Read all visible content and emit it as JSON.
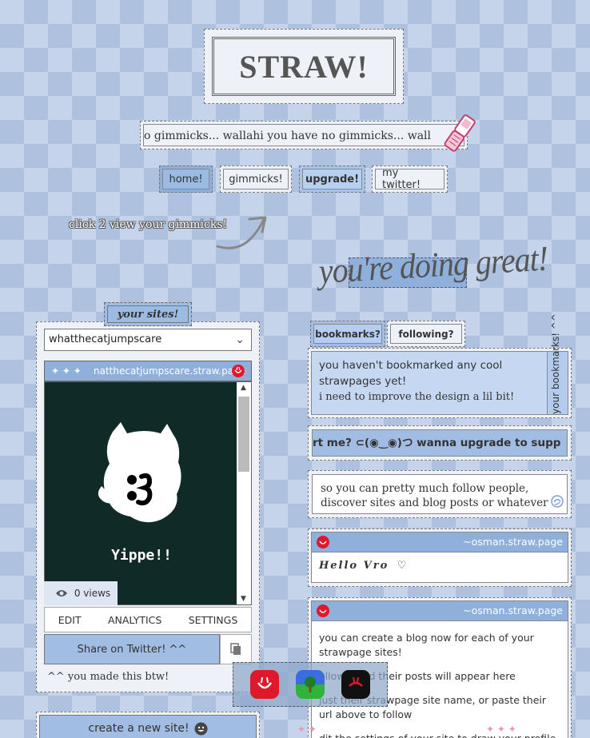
{
  "logo": {
    "text": "STRAW!"
  },
  "marquee": {
    "text": "o gimmicks...       wallahi you have no gimmicks...       wall"
  },
  "nav": {
    "home": "home!",
    "gimmicks": "gimmicks!",
    "upgrade": "upgrade!",
    "twitter": "my twitter!"
  },
  "hint": "click 2 view your gimmicks!",
  "slogan": "you're doing great!",
  "sites": {
    "tab_label": "your sites!",
    "selected_site": "whatthecatjumpscare",
    "site_url": "natthecatjumpscare.straw.page",
    "header_glyphs": "✦ ✦ ✦",
    "preview_text": "Yippe!!",
    "views": "0 views",
    "actions": {
      "edit": "EDIT",
      "analytics": "ANALYTICS",
      "settings": "SETTINGS"
    },
    "share": "Share on Twitter! ^^",
    "made_this": "^^ you made this btw!",
    "create": "create a new site!"
  },
  "right": {
    "tabs": {
      "bookmarks": "bookmarks?",
      "following": "following?"
    },
    "bookmarks_text_1": "you haven't bookmarked any cool strawpages yet!",
    "bookmarks_text_2": "i need to improve the design a lil bit!",
    "vertical_label": "your bookmarks! ^^",
    "marquee_upgrade": "rt me? ⊂(◉‿◉)つ        wanna upgrade to supp",
    "info_text": "so you can pretty much follow people, discover sites and blog posts or whatever",
    "post1": {
      "author": "~osman.straw.page",
      "text": "Hello Vro"
    },
    "post2": {
      "author": "~osman.straw.page",
      "line1": "you can create a blog now for each of your strawpage sites!",
      "line2": "ollow  s and their posts will appear here",
      "line3": "just  their strawpage site name, or paste their url above to follow",
      "line4": "dit the settings of your site to draw your profile pic!"
    }
  },
  "colors": {
    "accent": "#8fb0da",
    "logo_red": "#e0182c"
  }
}
